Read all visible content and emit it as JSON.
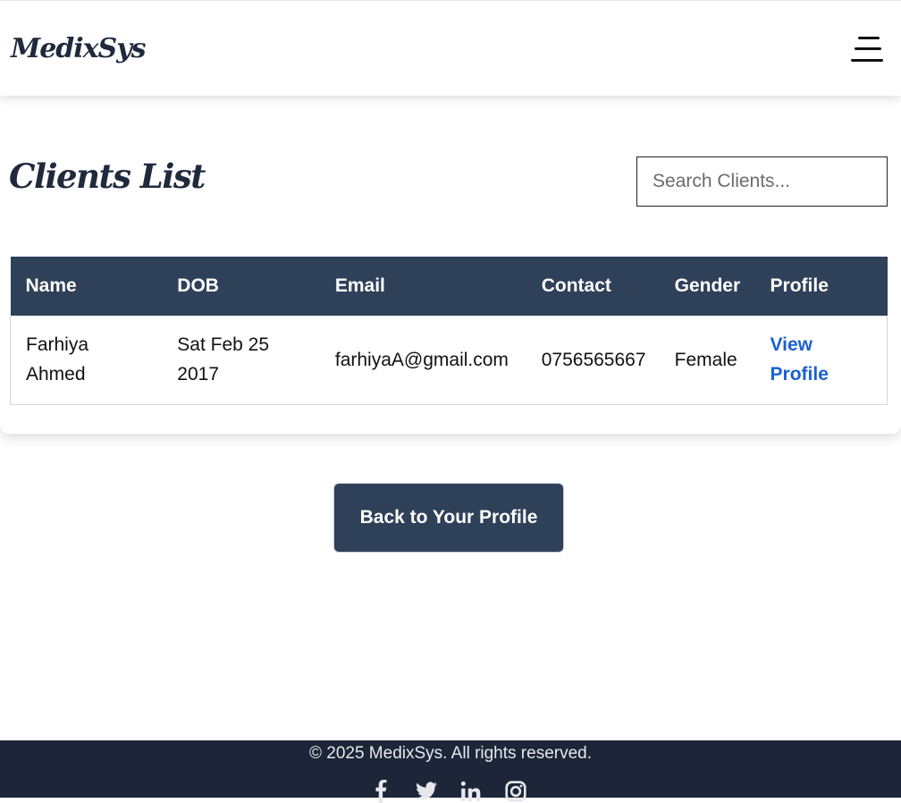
{
  "navbar": {
    "brand": "MedixSys",
    "menu_icon": "hamburger-menu-icon"
  },
  "main": {
    "title": "Clients List",
    "search": {
      "placeholder": "Search Clients...",
      "value": ""
    },
    "table": {
      "headers": [
        "Name",
        "DOB",
        "Email",
        "Contact",
        "Gender",
        "Profile"
      ],
      "rows": [
        {
          "name": "Farhiya Ahmed",
          "dob": "Sat Feb 25 2017",
          "email": "farhiyaA@gmail.com",
          "contact": "0756565667",
          "gender": "Female",
          "profile_link": "View Profile"
        }
      ]
    },
    "back_button": "Back to Your Profile"
  },
  "footer": {
    "copyright": "© 2025 MedixSys. All rights reserved.",
    "socials": [
      "facebook-icon",
      "twitter-icon",
      "linkedin-icon",
      "instagram-icon"
    ]
  },
  "colors": {
    "primary": "#2f4059",
    "footer_bg": "#1d2638",
    "link": "#1a5fd6",
    "brand_text": "#1f2a3c"
  }
}
